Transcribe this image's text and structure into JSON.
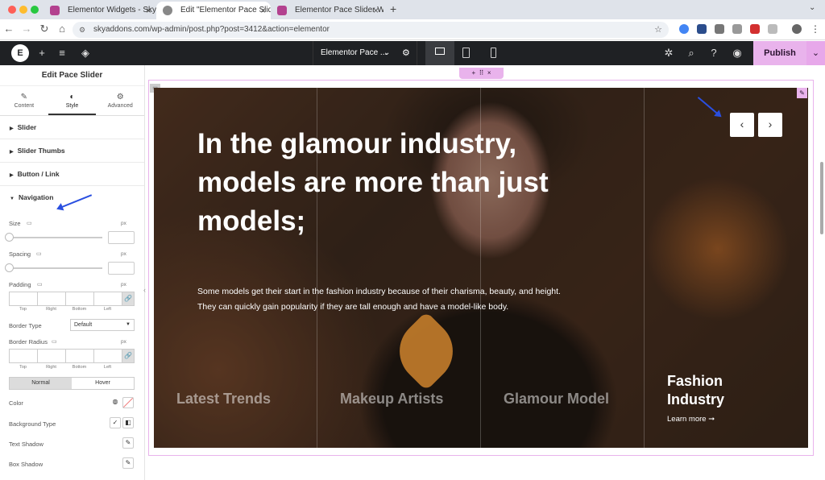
{
  "browser": {
    "tabs": [
      {
        "label": "Elementor Widgets - Sky Addo",
        "active": false
      },
      {
        "label": "Edit \"Elementor Pace Slider W",
        "active": true
      },
      {
        "label": "Elementor Pace Slider Widget",
        "active": false
      }
    ],
    "new_tab": "+",
    "url": "skyaddons.com/wp-admin/post.php?post=3412&action=elementor"
  },
  "topbar": {
    "doc_title": "Elementor Pace ...",
    "publish": "Publish"
  },
  "panel": {
    "title": "Edit Pace Slider",
    "tabs": [
      {
        "label": "Content",
        "icon": "pencil-icon"
      },
      {
        "label": "Style",
        "icon": "half-circle-icon"
      },
      {
        "label": "Advanced",
        "icon": "gear-icon"
      }
    ],
    "sections": [
      "Slider",
      "Slider Thumbs",
      "Button / Link",
      "Navigation"
    ],
    "controls": {
      "size_label": "Size",
      "spacing_label": "Spacing",
      "padding_label": "Padding",
      "unit": "px",
      "dims": [
        "Top",
        "Right",
        "Bottom",
        "Left"
      ],
      "border_type_label": "Border Type",
      "border_type_value": "Default",
      "border_radius_label": "Border Radius",
      "state_normal": "Normal",
      "state_hover": "Hover",
      "color_label": "Color",
      "bg_type_label": "Background Type",
      "text_shadow_label": "Text Shadow",
      "box_shadow_label": "Box Shadow"
    }
  },
  "slider": {
    "headline": "In the glamour industry, models are more than just models;",
    "subtext": "Some models get their start in the fashion industry because of their charisma, beauty, and height. They can quickly gain popularity if they are tall enough and have a model-like body.",
    "thumbs": [
      "Latest Trends",
      "Makeup Artists",
      "Glamour Model"
    ],
    "active_thumb": {
      "title": "Fashion Industry",
      "link": "Learn more"
    }
  },
  "colors": {
    "accent": "#e9b3ec",
    "annotation_arrow": "#2a4fe0",
    "topbar": "#1f2124"
  }
}
